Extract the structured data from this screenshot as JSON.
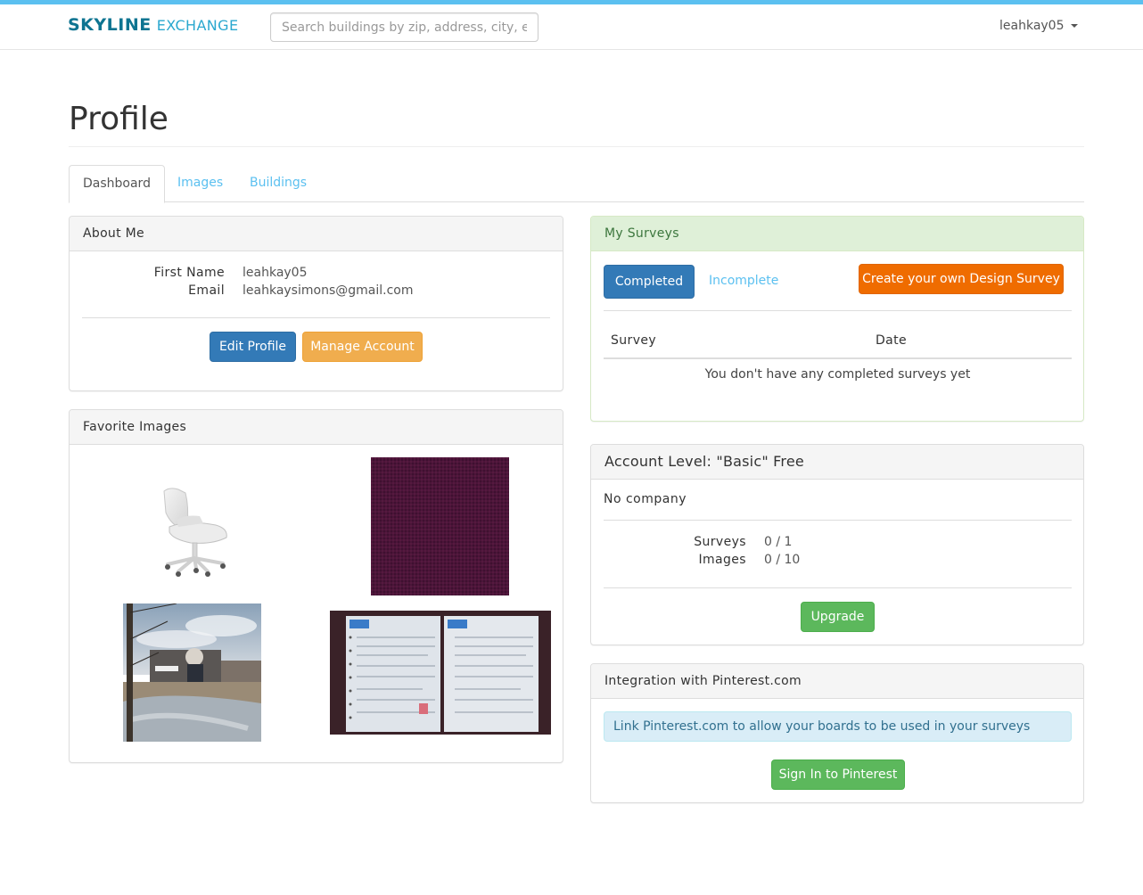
{
  "nav": {
    "brand_primary": "SKYLINE",
    "brand_secondary": "EXCHANGE",
    "search_placeholder": "Search buildings by zip, address, city, etc...",
    "username": "leahkay05"
  },
  "page": {
    "title": "Profile"
  },
  "tabs": [
    {
      "label": "Dashboard",
      "active": true
    },
    {
      "label": "Images",
      "active": false
    },
    {
      "label": "Buildings",
      "active": false
    }
  ],
  "about_me": {
    "heading": "About Me",
    "fields": [
      {
        "label": "First Name",
        "value": "leahkay05"
      },
      {
        "label": "Email",
        "value": "leahkaysimons@gmail.com"
      }
    ],
    "edit_profile_label": "Edit Profile",
    "manage_account_label": "Manage Account"
  },
  "favorite_images": {
    "heading": "Favorite Images",
    "items": [
      {
        "name": "white office chair"
      },
      {
        "name": "purple fabric swatch"
      },
      {
        "name": "street art mural photo"
      },
      {
        "name": "document pages photo"
      }
    ]
  },
  "my_surveys": {
    "heading": "My Surveys",
    "completed_label": "Completed",
    "incomplete_label": "Incomplete",
    "create_label": "Create your own Design Survey",
    "columns": [
      "Survey",
      "Date"
    ],
    "empty_message": "You don't have any completed surveys yet"
  },
  "account_level": {
    "heading": "Account Level: \"Basic\" Free",
    "company": "No company",
    "usage": [
      {
        "label": "Surveys",
        "value": "0 / 1"
      },
      {
        "label": "Images",
        "value": "0 / 10"
      }
    ],
    "upgrade_label": "Upgrade"
  },
  "pinterest": {
    "heading": "Integration with Pinterest.com",
    "info": "Link Pinterest.com to allow your boards to be used in your surveys",
    "signin_label": "Sign In to Pinterest"
  },
  "colors": {
    "accent_stripe": "#5bc0f0",
    "brand_dark": "#0e7491",
    "brand_light": "#2aa8cf",
    "primary": "#337ab7",
    "warning": "#f0ad4e",
    "success": "#5cb85c",
    "orange": "#ef6c00"
  }
}
